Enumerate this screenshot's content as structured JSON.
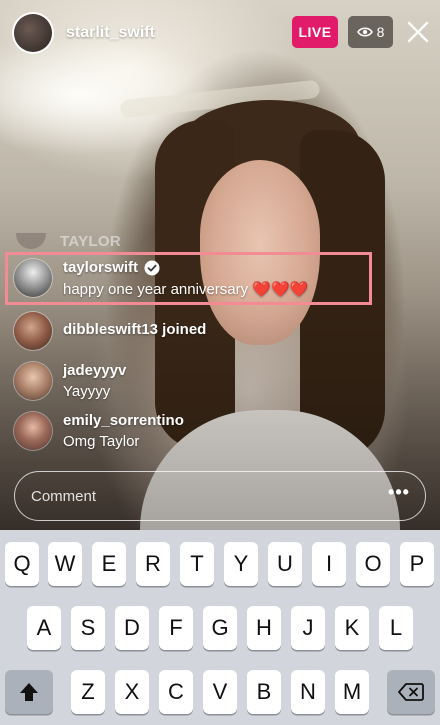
{
  "header": {
    "host_name": "starlit_swift",
    "live_label": "LIVE",
    "viewer_count": "8"
  },
  "comments": {
    "faded_name": "TAYLOR",
    "highlighted": {
      "username": "taylorswift",
      "text": "happy one year anniversary ❤️❤️❤️"
    },
    "joined": {
      "text": "dibbleswift13 joined"
    },
    "items": [
      {
        "username": "jadeyyyv",
        "text": "Yayyyy"
      },
      {
        "username": "emily_sorrentino",
        "text": "Omg Taylor"
      }
    ]
  },
  "input": {
    "placeholder": "Comment"
  },
  "keyboard": {
    "row1": [
      "Q",
      "W",
      "E",
      "R",
      "T",
      "Y",
      "U",
      "I",
      "O",
      "P"
    ],
    "row2": [
      "A",
      "S",
      "D",
      "F",
      "G",
      "H",
      "J",
      "K",
      "L"
    ],
    "row3": [
      "Z",
      "X",
      "C",
      "V",
      "B",
      "N",
      "M"
    ]
  },
  "colors": {
    "live_badge": "#e21a6a",
    "highlight_border": "#f28b93",
    "keyboard_bg": "#d2d5db"
  }
}
